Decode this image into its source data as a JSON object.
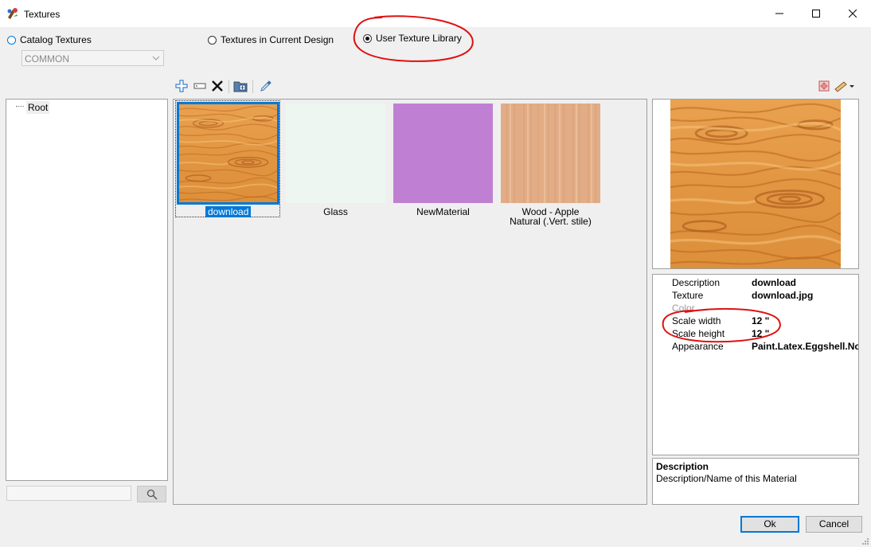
{
  "window": {
    "title": "Textures",
    "controls": [
      "minimize-icon",
      "maximize-icon",
      "close-icon"
    ]
  },
  "source_options": [
    {
      "label": "Catalog Textures",
      "selected": false
    },
    {
      "label": "Textures in Current Design",
      "selected": false
    },
    {
      "label": "User Texture Library",
      "selected": true
    }
  ],
  "catalog_combo": {
    "value": "COMMON",
    "enabled": false
  },
  "toolbar": {
    "icons": [
      "add-icon",
      "rename-icon",
      "delete-icon",
      "import-folder-icon",
      "eyedropper-icon"
    ],
    "right_icons": [
      "texture-options-icon",
      "measure-dropdown-icon"
    ]
  },
  "tree": {
    "items": [
      {
        "label": "Root"
      }
    ]
  },
  "search": {
    "value": "",
    "button_icon": "search-icon"
  },
  "textures": [
    {
      "label": "download",
      "selected": true,
      "kind": "wood-grain"
    },
    {
      "label": "Glass",
      "selected": false,
      "kind": "solid",
      "color": "#eef6f2"
    },
    {
      "label": "NewMaterial",
      "selected": false,
      "kind": "solid",
      "color": "#bf80d3"
    },
    {
      "label": "Wood - Apple\nNatural (.Vert. stile)",
      "selected": false,
      "kind": "light-wood"
    }
  ],
  "properties": [
    {
      "key": "Description",
      "value": "download",
      "enabled": true
    },
    {
      "key": "Texture",
      "value": "download.jpg",
      "enabled": true
    },
    {
      "key": "Color",
      "value": "",
      "enabled": false
    },
    {
      "key": "Scale width",
      "value": "12 \"",
      "enabled": true
    },
    {
      "key": "Scale height",
      "value": "12 \"",
      "enabled": true
    },
    {
      "key": "Appearance",
      "value": "Paint.Latex.Eggshell.No",
      "enabled": true
    }
  ],
  "help": {
    "title": "Description",
    "text": "Description/Name of this Material"
  },
  "buttons": {
    "ok": "Ok",
    "cancel": "Cancel"
  },
  "colors": {
    "accent": "#0078d7",
    "annotation": "#e01010",
    "wood": "#e39a45"
  }
}
